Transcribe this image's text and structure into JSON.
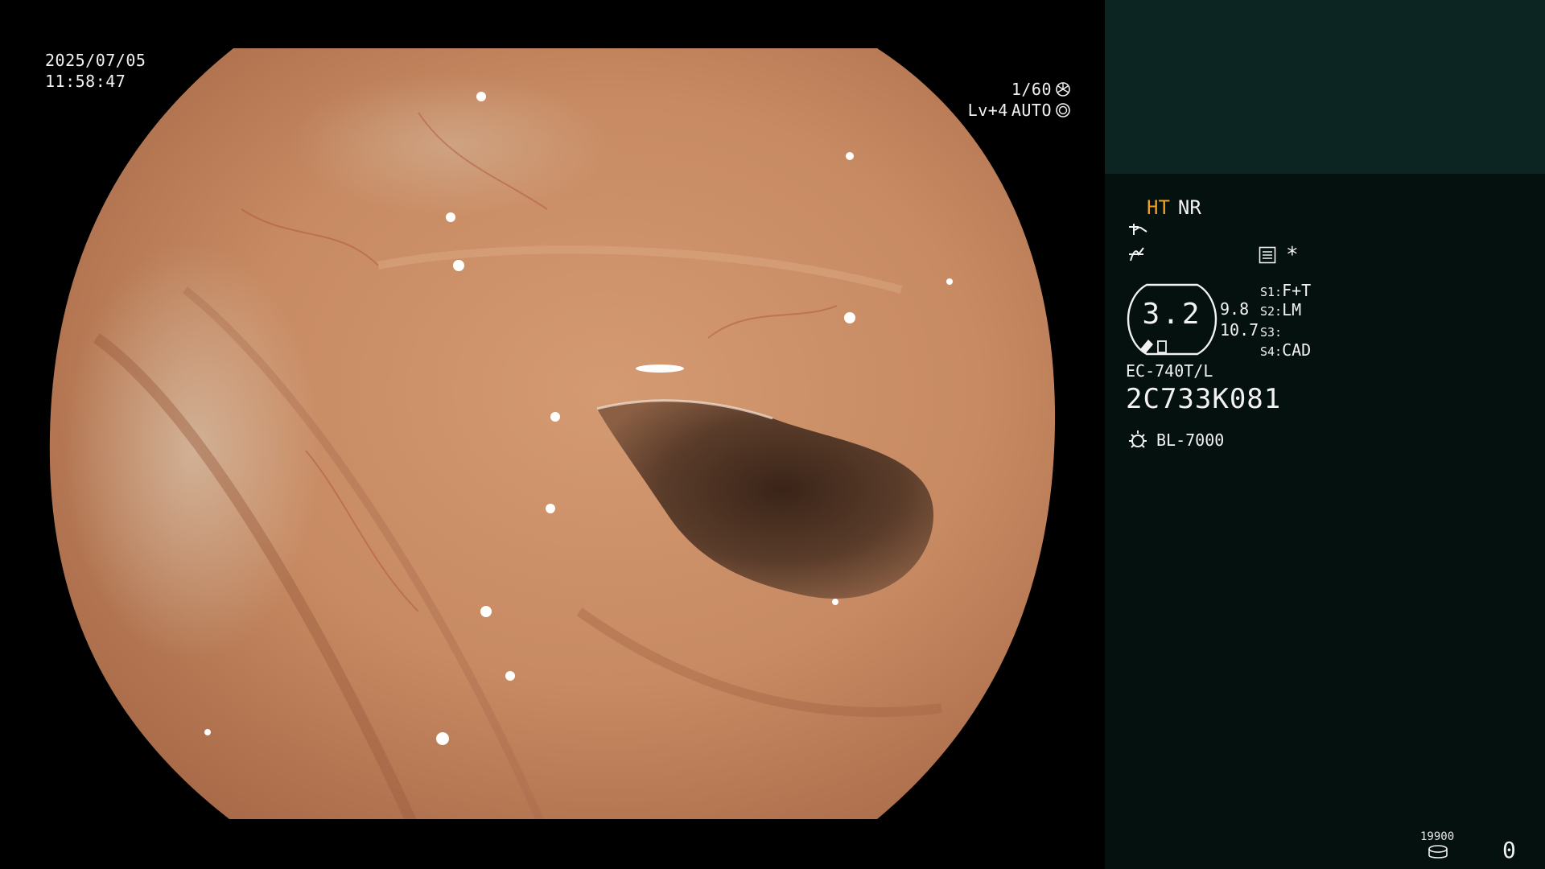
{
  "osd": {
    "date": "2025/07/05",
    "time": "11:58:47",
    "shutter": "1/60",
    "level": "Lv+4",
    "iris": "AUTO"
  },
  "panel": {
    "mode_primary": "HT",
    "mode_secondary": "NR",
    "star": "*",
    "gauge_value": "3.2",
    "gauge_aux": [
      "9.8",
      "10.7"
    ],
    "s_slots": [
      {
        "key": "S1:",
        "value": "F+T"
      },
      {
        "key": "S2:",
        "value": "LM"
      },
      {
        "key": "S3:",
        "value": ""
      },
      {
        "key": "S4:",
        "value": "CAD"
      }
    ],
    "scope_model": "EC-740T/L",
    "scope_serial": "2C733K081",
    "light_source": "BL-7000",
    "counter_small": "19900",
    "counter_main": "0"
  },
  "colors": {
    "panel_bg": "#05110f",
    "panel_top_bg": "#0d2522",
    "mode_accent": "#f0a020",
    "text": "#f2f2f2"
  },
  "icons": {
    "shutter": "aperture-icon",
    "iris": "iris-icon",
    "tone": "tone-curve-icon",
    "freq": "frequency-icon",
    "menu": "menu-list-icon",
    "light": "light-bulb-icon",
    "counter": "storage-disk-icon"
  }
}
